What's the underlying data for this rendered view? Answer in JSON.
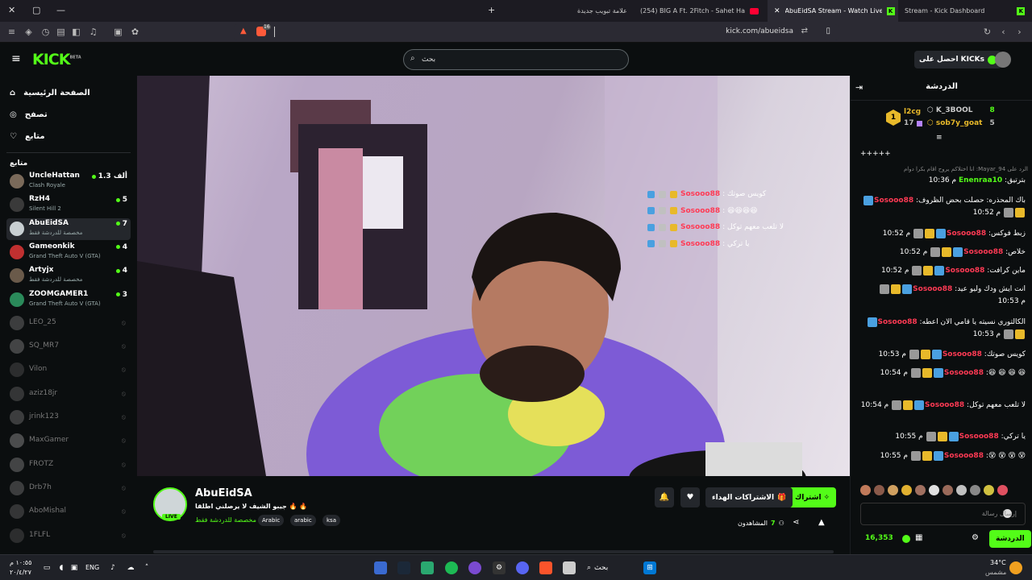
{
  "browser": {
    "tabs": [
      {
        "label": "علامة تبويب جديدة",
        "active": false
      },
      {
        "label": "(254) BIG A Ft. 2Fitch - Sahet Harb/...",
        "active": false
      },
      {
        "label": "AbuEidSA Stream - Watch Live o...",
        "active": true
      },
      {
        "label": "Stream - Kick Dashboard",
        "active": false
      }
    ],
    "url": "kick.com/abueidsa",
    "shield_count": "16"
  },
  "site": {
    "logo": "KICK",
    "logo_beta": "BETA",
    "search_placeholder": "بحث",
    "get_kicks": "احصل على KICKs"
  },
  "sidebar": {
    "nav": [
      {
        "label": "الصفحة الرئيسية",
        "icon": "home-icon"
      },
      {
        "label": "تصفح",
        "icon": "compass-icon"
      },
      {
        "label": "متابع",
        "icon": "heart-icon"
      }
    ],
    "following_title": "متابع",
    "channels": [
      {
        "name": "UncleHattan",
        "game": "Clash Royale",
        "viewers": "1.3 ألف",
        "live": true,
        "color": "#7a6a5a"
      },
      {
        "name": "RzH4",
        "game": "Silent Hill 2",
        "viewers": "5",
        "live": true,
        "color": "#3a3a3a"
      },
      {
        "name": "AbuEidSA",
        "game": "مخصصة للدردشة فقط",
        "viewers": "7",
        "live": true,
        "color": "#c8cfd2"
      },
      {
        "name": "Gameonkik",
        "game": "Grand Theft Auto V (GTA)",
        "viewers": "4",
        "live": true,
        "color": "#c03030"
      },
      {
        "name": "Artyjx",
        "game": "مخصصة للدردشة فقط",
        "viewers": "4",
        "live": true,
        "color": "#6a5a4a"
      },
      {
        "name": "ZOOMGAMER1",
        "game": "Grand Theft Auto V (GTA)",
        "viewers": "3",
        "live": true,
        "color": "#2a8a5a"
      },
      {
        "name": "LEO_25",
        "live": false,
        "color": "#777"
      },
      {
        "name": "SQ_MR7",
        "live": false,
        "color": "#888"
      },
      {
        "name": "Vilon",
        "live": false,
        "color": "#555"
      },
      {
        "name": "aziz18jr",
        "live": false,
        "color": "#666"
      },
      {
        "name": "jrink123",
        "live": false,
        "color": "#777"
      },
      {
        "name": "MaxGamer",
        "live": false,
        "color": "#999"
      },
      {
        "name": "FROTZ",
        "live": false,
        "color": "#888"
      },
      {
        "name": "Drb7h",
        "live": false,
        "color": "#777"
      },
      {
        "name": "AboMishal",
        "live": false,
        "color": "#666"
      },
      {
        "name": "1FLFL",
        "live": false,
        "color": "#555"
      }
    ]
  },
  "video": {
    "overlay_messages": [
      {
        "user": "Sosooo88",
        "text": ": كويس صوتك"
      },
      {
        "user": "Sosooo88",
        "text": ": 😆😆😆😆"
      },
      {
        "user": "Sosooo88",
        "text": ": لا تلعب معهم توكل"
      },
      {
        "user": "Sosooo88",
        "text": ": يا تركي"
      }
    ]
  },
  "stream": {
    "streamer": "AbuEidSA",
    "live_badge": "LIVE",
    "title": "جيبو الشيف لا يرصلني اطلقا 🔥 🔥",
    "category": "مخصصة للدردشة فقط",
    "tags": [
      "Arabic",
      "arabic",
      "ksa"
    ],
    "subscribe_label": "اشتراك",
    "gift_label": "الاشتراكات الهداء",
    "viewers_label": "المشاهدون",
    "viewers_count": "7"
  },
  "chat": {
    "title": "الدردشة",
    "leaderboard": [
      {
        "rank": "1",
        "name": "l2cg",
        "count": "17"
      },
      {
        "name": "K_3BOOL",
        "count": "8"
      },
      {
        "name": "sob7y_goat",
        "count": "5"
      }
    ],
    "top_text": "+++++",
    "reply_text": "الرد على Mayar_94: انا اختلاكم يروح اقام بكرا دوام",
    "messages": [
      {
        "time": "10:36 م",
        "user": "Enenraa10",
        "text": "بترتيق",
        "color": "#53fc18"
      },
      {
        "time": "10:52 م",
        "user": "Sosooo88",
        "text": "باك المحذره: حصلت بحض الظروف"
      },
      {
        "time": "10:52 م",
        "user": "Sosooo88",
        "text": "زبط فوكس"
      },
      {
        "time": "10:52 م",
        "user": "Sosooo88",
        "text": "خلاص"
      },
      {
        "time": "10:52 م",
        "user": "Sosooo88",
        "text": "ماين كرافت"
      },
      {
        "time": "10:53 م",
        "user": "Sosooo88",
        "text": "انت ايش ودك وليو عيد"
      },
      {
        "time": "10:53 م",
        "user": "Sosooo88",
        "text": "الكالتوري نسيته يا قامي الان اعطه"
      },
      {
        "time": "10:53 م",
        "user": "Sosooo88",
        "text": "كويس صوتك"
      },
      {
        "time": "10:54 م",
        "user": "Sosooo88",
        "text": "😆 😆 😆 😆"
      },
      {
        "time": "10:54 م",
        "user": "Sosooo88",
        "text": "لا تلعب معهم توكل"
      },
      {
        "time": "10:55 م",
        "user": "Sosooo88",
        "text": "يا تركي"
      },
      {
        "time": "10:55 م",
        "user": "Sosooo88",
        "text": "😵 😵 😵 😵"
      }
    ],
    "input_placeholder": "إرسال رسالة",
    "send_label": "الدردشة",
    "kicks_count": "16,353"
  },
  "taskbar": {
    "search_label": "بحث",
    "lang": "ENG",
    "time": "١٠:٥٥ م",
    "date": "٢٠/٤/٢٧",
    "weather_temp": "34°C",
    "weather_desc": "مشمس"
  }
}
